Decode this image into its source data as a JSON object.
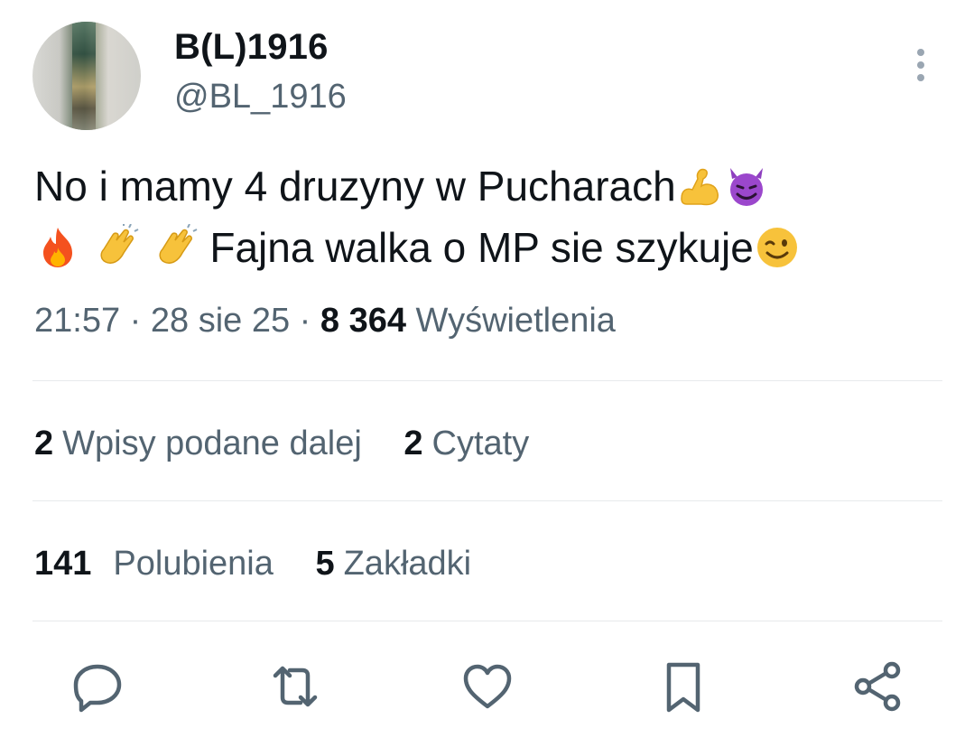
{
  "author": {
    "display_name": "B(L)1916",
    "handle": "@BL_1916"
  },
  "tweet": {
    "line1_text": "No i mamy 4 druzyny w Pucharach",
    "line1_emojis": [
      "flexed-biceps",
      "smiling-devil"
    ],
    "line2_leading_emojis": [
      "fire",
      "clapping-hands",
      "clapping-hands"
    ],
    "line2_text": "Fajna walka o MP sie szykuje",
    "line2_trailing_emojis": [
      "winking-face"
    ]
  },
  "meta": {
    "time": "21:57",
    "sep1": "·",
    "date": "28 sie 25",
    "sep2": "·",
    "views_count": "8 364",
    "views_label": "Wyświetlenia"
  },
  "stats": {
    "reposts_count": "2",
    "reposts_label": "Wpisy podane dalej",
    "quotes_count": "2",
    "quotes_label": "Cytaty",
    "likes_count": "141",
    "likes_label": "Polubienia",
    "bookmarks_count": "5",
    "bookmarks_label": "Zakładki"
  },
  "actions": [
    "reply-icon",
    "repost-icon",
    "like-icon",
    "bookmark-icon",
    "share-icon"
  ],
  "colors": {
    "text_primary": "#0f1419",
    "text_secondary": "#536471",
    "divider": "#e7eaec"
  }
}
